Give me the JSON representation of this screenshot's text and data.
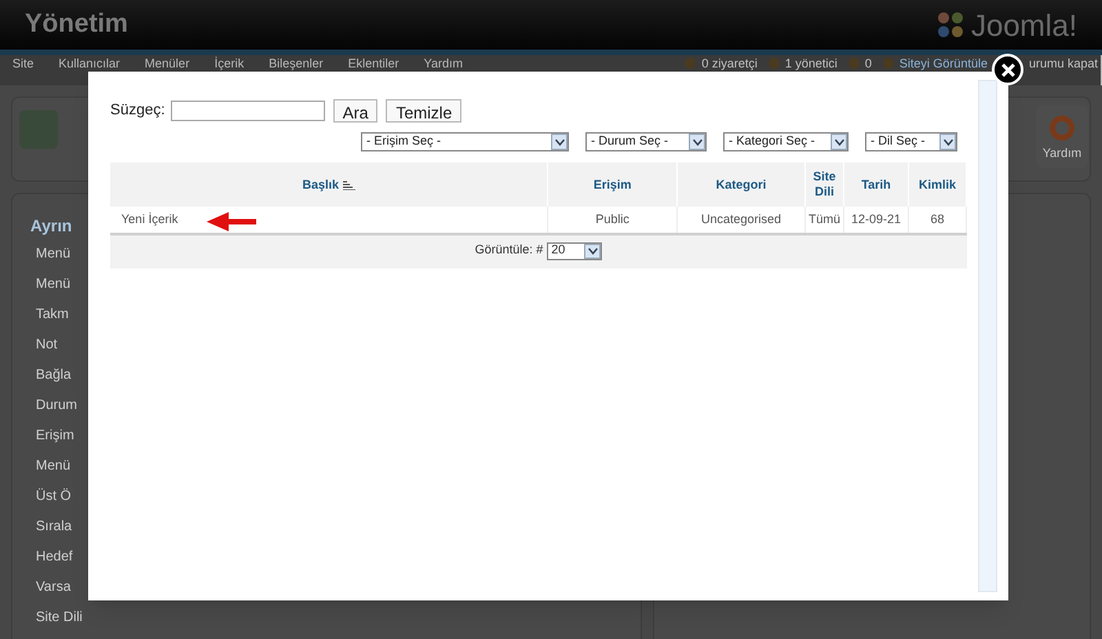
{
  "header": {
    "title": "Yönetim",
    "logo": "Joomla!"
  },
  "menu": [
    {
      "label": "Site"
    },
    {
      "label": "Kullanıcılar"
    },
    {
      "label": "Menüler"
    },
    {
      "label": "İçerik"
    },
    {
      "label": "Bileşenler"
    },
    {
      "label": "Eklentiler"
    },
    {
      "label": "Yardım"
    }
  ],
  "status": [
    {
      "kind": "visitors",
      "label": "0 ziyaretçi"
    },
    {
      "kind": "admins",
      "label": "1 yönetici"
    },
    {
      "kind": "messages",
      "label": "0"
    },
    {
      "kind": "view",
      "label": "Siteyi Görüntüle"
    },
    {
      "kind": "logout",
      "label": "urumu kapat"
    }
  ],
  "toolbar": {
    "help": "Yardım"
  },
  "sidebar": {
    "heading": "Ayrın",
    "labels": [
      "Menü",
      "Menü",
      "Takm",
      "Not",
      "Bağla",
      "Durum",
      "Erişim",
      "Menü",
      "Üst Ö",
      "Sırala",
      "Hedef",
      "Varsa",
      "Site Dili"
    ]
  },
  "modal": {
    "filter_label": "Süzgeç:",
    "buttons": [
      "Ara",
      "Temizle"
    ],
    "selects": [
      {
        "value": "- Erişim Seç -"
      },
      {
        "value": "- Durum Seç -"
      },
      {
        "value": "- Kategori Seç -"
      },
      {
        "value": "- Dil Seç -"
      }
    ],
    "table": {
      "columns": [
        "Başlık",
        "Erişim",
        "Kategori",
        "Site Dili",
        "Tarih",
        "Kimlik"
      ],
      "rows": [
        [
          "Yeni İçerik",
          "Public",
          "Uncategorised",
          "Tümü",
          "12-09-21",
          "68"
        ]
      ]
    },
    "pagination": {
      "label": "Görüntüle: #",
      "value": "20"
    }
  }
}
